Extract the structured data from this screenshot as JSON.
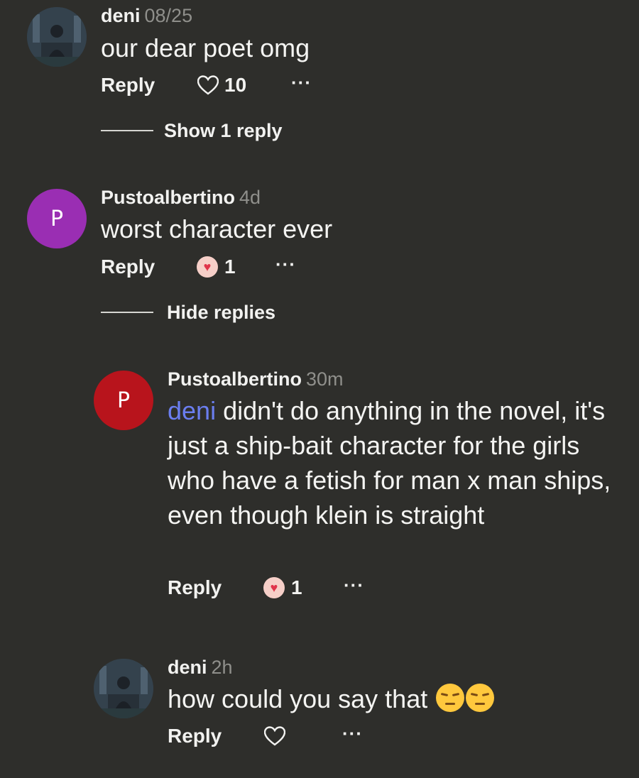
{
  "comments": [
    {
      "username": "deni",
      "time": "08/25",
      "text": "our dear poet omg",
      "reply_label": "Reply",
      "likes": "10",
      "more": "···",
      "replies_toggle": "Show 1 reply"
    },
    {
      "username": "Pustoalbertino",
      "avatar_letter": "P",
      "avatar_color": "#9a2eb3",
      "time": "4d",
      "text": "worst character ever",
      "reply_label": "Reply",
      "likes": "1",
      "more": "···",
      "replies_toggle": "Hide replies"
    }
  ],
  "replies": [
    {
      "username": "Pustoalbertino",
      "avatar_letter": "P",
      "avatar_color": "#b8141c",
      "time": "30m",
      "mention": "deni",
      "text": " didn't do anything in the novel, it's just a ship-bait character for the girls who have a fetish for man x man ships, even though klein is straight",
      "reply_label": "Reply",
      "likes": "1",
      "more": "···"
    },
    {
      "username": "deni",
      "time": "2h",
      "text": "how could you say that ",
      "reply_label": "Reply",
      "more": "···"
    }
  ],
  "colors": {
    "background": "#2e2e2b",
    "mention": "#6b7ef0",
    "timestamp": "#8f8f8b"
  },
  "icons": [
    "heart-outline-icon",
    "heart-face-emoji",
    "pensive-face-emoji",
    "more-dots-icon"
  ]
}
